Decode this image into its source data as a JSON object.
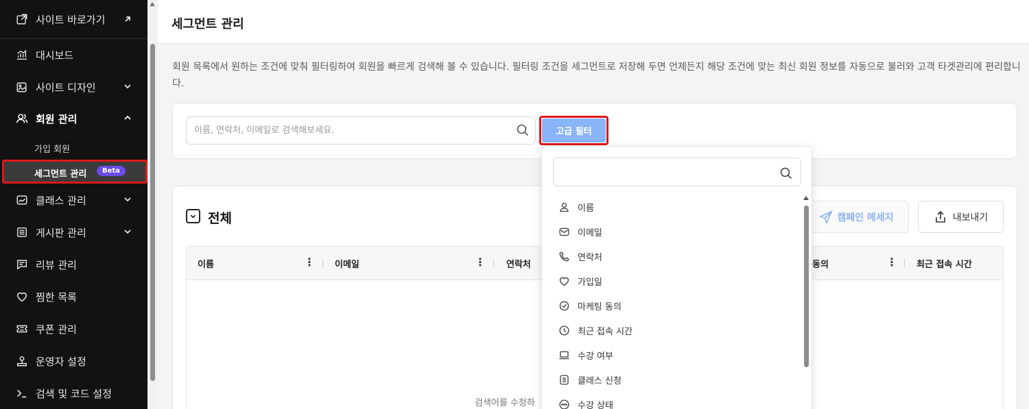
{
  "sidebar": {
    "items": [
      {
        "label": "사이트 바로가기",
        "icon": "external-link-icon"
      },
      {
        "label": "대시보드",
        "icon": "dashboard-icon"
      },
      {
        "label": "사이트 디자인",
        "icon": "design-icon"
      },
      {
        "label": "회원 관리",
        "icon": "users-icon"
      },
      {
        "label": "클래스 관리",
        "icon": "class-icon"
      },
      {
        "label": "게시판 관리",
        "icon": "board-icon"
      },
      {
        "label": "리뷰 관리",
        "icon": "review-icon"
      },
      {
        "label": "찜한 목록",
        "icon": "heart-icon"
      },
      {
        "label": "쿠폰 관리",
        "icon": "coupon-icon"
      },
      {
        "label": "운영자 설정",
        "icon": "admin-icon"
      },
      {
        "label": "검색 및 코드 설정",
        "icon": "terminal-icon"
      }
    ],
    "sub_items": [
      {
        "label": "가입 회원"
      },
      {
        "label": "세그먼트 관리",
        "badge": "Beta"
      }
    ]
  },
  "page": {
    "title": "세그먼트 관리",
    "description": "회원 목록에서 원하는 조건에 맞춰 필터링하여 회원을 빠르게 검색해 볼 수 있습니다. 필터링 조건을 세그먼트로 저장해 두면 언제든지 해당 조건에 맞는 최신 회원 정보를 자동으로 불러와 고객 타겟관리에 편리합니다."
  },
  "search": {
    "placeholder": "이름, 연락처, 이메일로 검색해보세요.",
    "advanced_filter_label": "고급 필터"
  },
  "list": {
    "all_label": "전체",
    "campaign_button": "캠페인 메세지",
    "export_button": "내보내기",
    "columns": [
      "이름",
      "이메일",
      "연락처",
      "동의",
      "최근 접속 시간"
    ],
    "empty_text": "검색어를 수정하"
  },
  "dropdown": {
    "items": [
      {
        "label": "이름",
        "icon": "person-icon"
      },
      {
        "label": "이메일",
        "icon": "mail-icon"
      },
      {
        "label": "연락처",
        "icon": "phone-icon"
      },
      {
        "label": "가입일",
        "icon": "heart-icon"
      },
      {
        "label": "마케팅 동의",
        "icon": "check-circle-icon"
      },
      {
        "label": "최근 접속 시간",
        "icon": "clock-icon"
      },
      {
        "label": "수강 여부",
        "icon": "laptop-icon"
      },
      {
        "label": "클래스 신청",
        "icon": "form-icon"
      },
      {
        "label": "수강 상태",
        "icon": "status-icon"
      }
    ]
  },
  "colors": {
    "sidebar_bg": "#121212",
    "highlight": "#e01818",
    "beta_badge": "#6b4ce6",
    "primary_button": "#8ab4f8"
  }
}
